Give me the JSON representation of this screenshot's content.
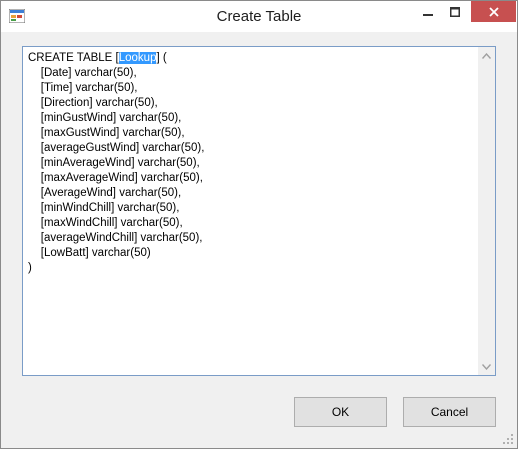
{
  "window": {
    "title": "Create Table",
    "icon": "window-app-icon"
  },
  "titlebar_controls": {
    "minimize": {
      "icon": "minimize-icon",
      "symbol": "‒"
    },
    "maximize": {
      "icon": "maximize-icon",
      "symbol": "☐"
    },
    "close": {
      "icon": "close-icon",
      "symbol": "✕",
      "color": "#c75050"
    }
  },
  "editor": {
    "prefix": "CREATE TABLE [",
    "selected": "Lookup",
    "suffix": "] (\n    [Date] varchar(50),\n    [Time] varchar(50),\n    [Direction] varchar(50),\n    [minGustWind] varchar(50),\n    [maxGustWind] varchar(50),\n    [averageGustWind] varchar(50),\n    [minAverageWind] varchar(50),\n    [maxAverageWind] varchar(50),\n    [AverageWind] varchar(50),\n    [minWindChill] varchar(50),\n    [maxWindChill] varchar(50),\n    [averageWindChill] varchar(50),\n    [LowBatt] varchar(50)\n)",
    "selection_color": "#3399ff"
  },
  "buttons": {
    "ok": "OK",
    "cancel": "Cancel"
  }
}
